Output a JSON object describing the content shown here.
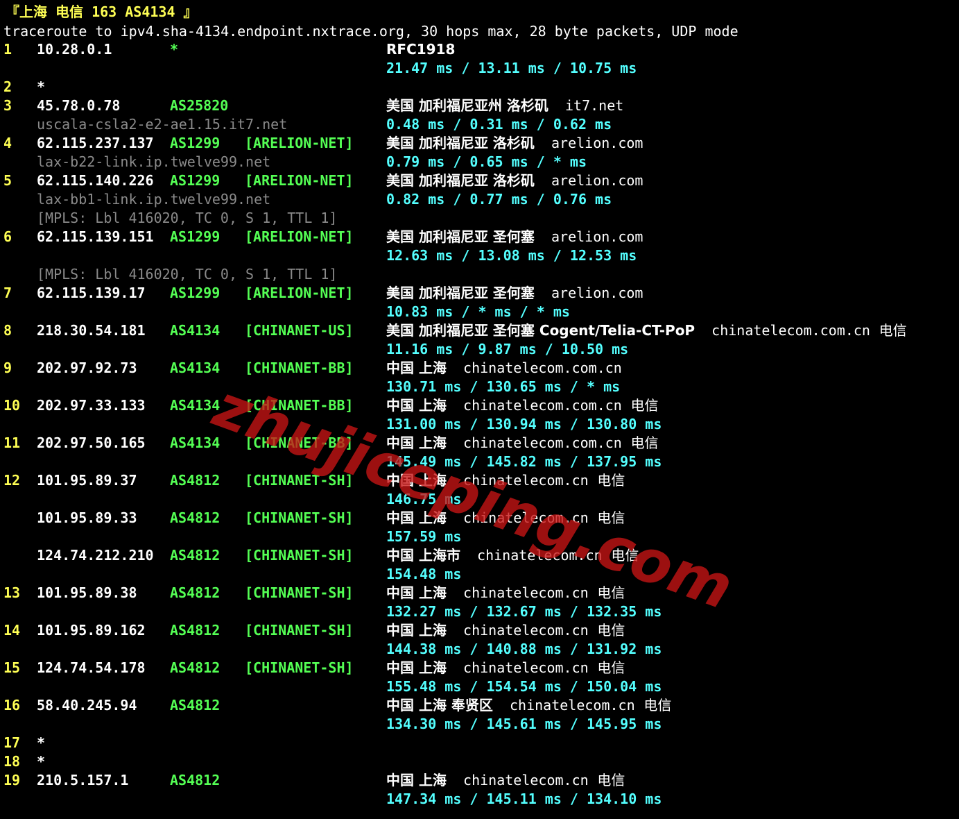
{
  "header": "『上海 电信 163 AS4134 』",
  "command": "traceroute to ipv4.sha-4134.endpoint.nxtrace.org, 30 hops max, 28 byte packets, UDP mode",
  "colors": {
    "background": "#000000",
    "hop": "#ffff54",
    "asn": "#54ff54",
    "rtt": "#54ffff",
    "rdns": "#8a8a8a",
    "watermark": "#c81414"
  },
  "watermark": "zhujiceping.com",
  "rows": [
    {
      "hop": "1",
      "ip": "10.28.0.1",
      "as": "*",
      "net": "",
      "geo": "RFC1918",
      "domain": "",
      "isp": "",
      "rtt": "21.47 ms / 13.11 ms / 10.75 ms"
    },
    {
      "hop": "2",
      "ip": "*"
    },
    {
      "hop": "3",
      "ip": "45.78.0.78",
      "as": "AS25820",
      "net": "",
      "geo": "美国 加利福尼亚州 洛杉矶",
      "domain": "it7.net",
      "isp": "",
      "rdns": "uscala-csla2-e2-ae1.15.it7.net",
      "rtt": "0.48 ms / 0.31 ms / 0.62 ms"
    },
    {
      "hop": "4",
      "ip": "62.115.237.137",
      "as": "AS1299",
      "net": "[ARELION-NET]",
      "geo": "美国 加利福尼亚 洛杉矶",
      "domain": "arelion.com",
      "isp": "",
      "rdns": "lax-b22-link.ip.twelve99.net",
      "rtt": "0.79 ms / 0.65 ms / * ms"
    },
    {
      "hop": "5",
      "ip": "62.115.140.226",
      "as": "AS1299",
      "net": "[ARELION-NET]",
      "geo": "美国 加利福尼亚 洛杉矶",
      "domain": "arelion.com",
      "isp": "",
      "rdns": "lax-bb1-link.ip.twelve99.net",
      "rtt": "0.82 ms / 0.77 ms / 0.76 ms",
      "mpls": "[MPLS: Lbl 416020, TC 0, S 1, TTL 1]"
    },
    {
      "hop": "6",
      "ip": "62.115.139.151",
      "as": "AS1299",
      "net": "[ARELION-NET]",
      "geo": "美国 加利福尼亚 圣何塞",
      "domain": "arelion.com",
      "isp": "",
      "rtt": "12.63 ms / 13.08 ms / 12.53 ms",
      "mpls": "[MPLS: Lbl 416020, TC 0, S 1, TTL 1]"
    },
    {
      "hop": "7",
      "ip": "62.115.139.17",
      "as": "AS1299",
      "net": "[ARELION-NET]",
      "geo": "美国 加利福尼亚 圣何塞",
      "domain": "arelion.com",
      "isp": "",
      "rtt": "10.83 ms / * ms / * ms"
    },
    {
      "hop": "8",
      "ip": "218.30.54.181",
      "as": "AS4134",
      "net": "[CHINANET-US]",
      "geo": "美国 加利福尼亚 圣何塞 Cogent/Telia-CT-PoP",
      "domain": "chinatelecom.com.cn",
      "isp": "电信",
      "rtt": "11.16 ms / 9.87 ms / 10.50 ms"
    },
    {
      "hop": "9",
      "ip": "202.97.92.73",
      "as": "AS4134",
      "net": "[CHINANET-BB]",
      "geo": "中国 上海",
      "domain": "chinatelecom.com.cn",
      "isp": "",
      "rtt": "130.71 ms / 130.65 ms / * ms"
    },
    {
      "hop": "10",
      "ip": "202.97.33.133",
      "as": "AS4134",
      "net": "[CHINANET-BB]",
      "geo": "中国 上海",
      "domain": "chinatelecom.com.cn",
      "isp": "电信",
      "rtt": "131.00 ms / 130.94 ms / 130.80 ms"
    },
    {
      "hop": "11",
      "ip": "202.97.50.165",
      "as": "AS4134",
      "net": "[CHINANET-BB]",
      "geo": "中国 上海",
      "domain": "chinatelecom.com.cn",
      "isp": "电信",
      "rtt": "145.49 ms / 145.82 ms / 137.95 ms"
    },
    {
      "hop": "12",
      "ip": "101.95.89.37",
      "as": "AS4812",
      "net": "[CHINANET-SH]",
      "geo": "中国 上海",
      "domain": "chinatelecom.cn",
      "isp": "电信",
      "rtt": "146.75 ms"
    },
    {
      "hop": "",
      "ip": "101.95.89.33",
      "as": "AS4812",
      "net": "[CHINANET-SH]",
      "geo": "中国 上海",
      "domain": "chinatelecom.cn",
      "isp": "电信",
      "rtt": "157.59 ms"
    },
    {
      "hop": "",
      "ip": "124.74.212.210",
      "as": "AS4812",
      "net": "[CHINANET-SH]",
      "geo": "中国 上海市",
      "domain": "chinatelecom.cn",
      "isp": "电信",
      "rtt": "154.48 ms"
    },
    {
      "hop": "13",
      "ip": "101.95.89.38",
      "as": "AS4812",
      "net": "[CHINANET-SH]",
      "geo": "中国 上海",
      "domain": "chinatelecom.cn",
      "isp": "电信",
      "rtt": "132.27 ms / 132.67 ms / 132.35 ms"
    },
    {
      "hop": "14",
      "ip": "101.95.89.162",
      "as": "AS4812",
      "net": "[CHINANET-SH]",
      "geo": "中国 上海",
      "domain": "chinatelecom.cn",
      "isp": "电信",
      "rtt": "144.38 ms / 140.88 ms / 131.92 ms"
    },
    {
      "hop": "15",
      "ip": "124.74.54.178",
      "as": "AS4812",
      "net": "[CHINANET-SH]",
      "geo": "中国 上海",
      "domain": "chinatelecom.cn",
      "isp": "电信",
      "rtt": "155.48 ms / 154.54 ms / 150.04 ms"
    },
    {
      "hop": "16",
      "ip": "58.40.245.94",
      "as": "AS4812",
      "net": "",
      "geo": "中国 上海 奉贤区",
      "domain": "chinatelecom.cn",
      "isp": "电信",
      "rtt": "134.30 ms / 145.61 ms / 145.95 ms"
    },
    {
      "hop": "17",
      "ip": "*"
    },
    {
      "hop": "18",
      "ip": "*"
    },
    {
      "hop": "19",
      "ip": "210.5.157.1",
      "as": "AS4812",
      "net": "",
      "geo": "中国 上海",
      "domain": "chinatelecom.cn",
      "isp": "电信",
      "rtt": "147.34 ms / 145.11 ms / 134.10 ms"
    }
  ]
}
